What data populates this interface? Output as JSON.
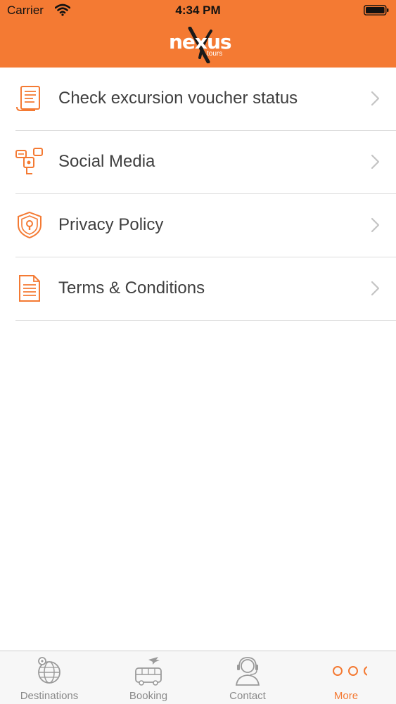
{
  "status_bar": {
    "carrier": "Carrier",
    "time": "4:34 PM"
  },
  "header": {
    "logo_text": "nexus",
    "logo_sub": "tours",
    "background_color": "#f47a33"
  },
  "menu": {
    "items": [
      {
        "label": "Check excursion voucher status",
        "icon": "voucher-scroll-icon"
      },
      {
        "label": "Social Media",
        "icon": "social-media-icon"
      },
      {
        "label": "Privacy Policy",
        "icon": "shield-lock-icon"
      },
      {
        "label": "Terms & Conditions",
        "icon": "document-icon"
      }
    ]
  },
  "tab_bar": {
    "tabs": [
      {
        "label": "Destinations",
        "icon": "globe-pin-icon",
        "active": false
      },
      {
        "label": "Booking",
        "icon": "bus-plane-icon",
        "active": false
      },
      {
        "label": "Contact",
        "icon": "headset-agent-icon",
        "active": false
      },
      {
        "label": "More",
        "icon": "more-dots-icon",
        "active": true
      }
    ],
    "active_color": "#f47a33",
    "inactive_color": "#8a8a8a"
  }
}
